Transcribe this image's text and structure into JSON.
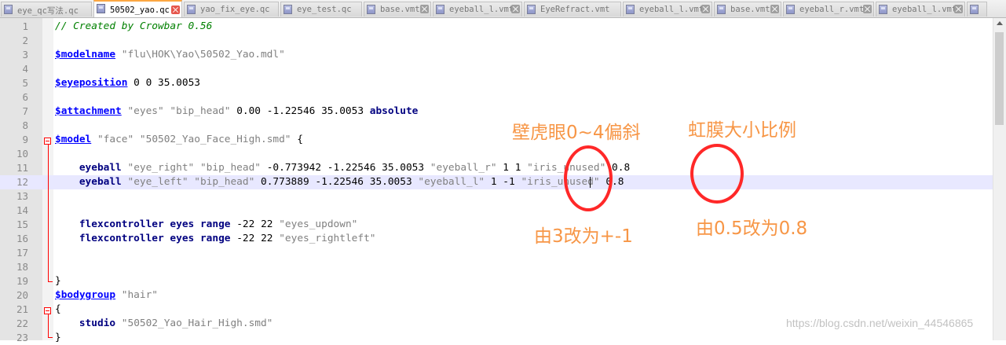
{
  "tabs": [
    {
      "label": "eye_qc写法.qc",
      "active": false
    },
    {
      "label": "50502_yao.qc",
      "active": true
    },
    {
      "label": "yao_fix_eye.qc",
      "active": false
    },
    {
      "label": "eye_test.qc",
      "active": false
    },
    {
      "label": "base.vmt",
      "active": false
    },
    {
      "label": "eyeball_l.vmt",
      "active": false
    },
    {
      "label": "EyeRefract.vmt",
      "active": false
    },
    {
      "label": "eyeball_l.vmt",
      "active": false
    },
    {
      "label": "base.vmt",
      "active": false
    },
    {
      "label": "eyeball_r.vmt",
      "active": false
    },
    {
      "label": "eyeball_l.vmt",
      "active": false
    }
  ],
  "editor": {
    "lines": [
      {
        "n": "1",
        "text": "// Created by Crowbar 0.56"
      },
      {
        "n": "2",
        "text": ""
      },
      {
        "n": "3",
        "text": "$modelname \"flu\\HOK\\Yao\\50502_Yao.mdl\""
      },
      {
        "n": "4",
        "text": ""
      },
      {
        "n": "5",
        "text": "$eyeposition 0 0 35.0053"
      },
      {
        "n": "6",
        "text": ""
      },
      {
        "n": "7",
        "text": "$attachment \"eyes\" \"bip_head\" 0.00 -1.22546 35.0053 absolute"
      },
      {
        "n": "8",
        "text": ""
      },
      {
        "n": "9",
        "text": "$model \"face\" \"50502_Yao_Face_High.smd\" {"
      },
      {
        "n": "10",
        "text": ""
      },
      {
        "n": "11",
        "text": "    eyeball \"eye_right\" \"bip_head\" -0.773942 -1.22546 35.0053 \"eyeball_r\" 1 1 \"iris_unused\" 0.8"
      },
      {
        "n": "12",
        "text": "    eyeball \"eye_left\" \"bip_head\" 0.773889 -1.22546 35.0053 \"eyeball_l\" 1 -1 \"iris_unused\" 0.8"
      },
      {
        "n": "13",
        "text": ""
      },
      {
        "n": "14",
        "text": ""
      },
      {
        "n": "15",
        "text": "    flexcontroller eyes range -22 22 \"eyes_updown\""
      },
      {
        "n": "16",
        "text": "    flexcontroller eyes range -22 22 \"eyes_rightleft\""
      },
      {
        "n": "17",
        "text": ""
      },
      {
        "n": "18",
        "text": ""
      },
      {
        "n": "19",
        "text": "}"
      },
      {
        "n": "20",
        "text": "$bodygroup \"hair\""
      },
      {
        "n": "21",
        "text": "{"
      },
      {
        "n": "22",
        "text": "    studio \"50502_Yao_Hair_High.smd\""
      },
      {
        "n": "23",
        "text": "}"
      }
    ]
  },
  "annotations": {
    "top_left": "壁虎眼0~4偏斜",
    "top_right": "虹膜大小比例",
    "bottom_left": "由3改为+-1",
    "bottom_right": "由0.5改为0.8"
  },
  "watermark": "https://blog.csdn.net/weixin_44546865",
  "colors": {
    "accent_tab": "#fca742",
    "annotation_text": "#f79646",
    "annotation_ring": "#ff2828",
    "keyword": "#0000ff",
    "bold_word": "#000080",
    "comment": "#008000",
    "string": "#808080"
  }
}
